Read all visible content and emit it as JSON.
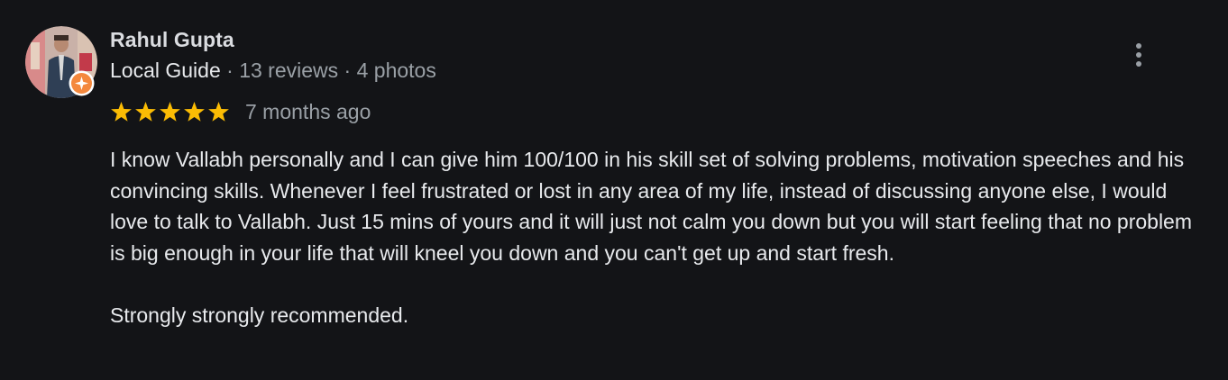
{
  "review": {
    "author_name": "Rahul Gupta",
    "author_badge": "Local Guide",
    "reviews_count": "13 reviews",
    "photos_count": "4 photos",
    "separator": " · ",
    "rating": 5,
    "rating_max": 5,
    "time_ago": "7 months ago",
    "text": "I know Vallabh personally and I can give him 100/100 in his skill set of solving problems, motivation speeches and his convincing skills. Whenever I feel frustrated or lost in any area of my life, instead of discussing anyone else, I would love to talk to Vallabh. Just 15 mins of yours and it will just not calm you down but you will start feeling that no problem is big enough in your life that will kneel you down and you can't get up and start fresh.\n\nStrongly strongly recommended."
  },
  "icons": {
    "avatar": "profile-photo",
    "badge": "local-guide-badge-icon",
    "more": "more-vert-icon",
    "star": "star-icon"
  },
  "colors": {
    "background": "#131417",
    "star": "#fbbc04",
    "badge": "#f4883d",
    "secondary_text": "#9aa0a6",
    "primary_text": "#e8eaed"
  }
}
